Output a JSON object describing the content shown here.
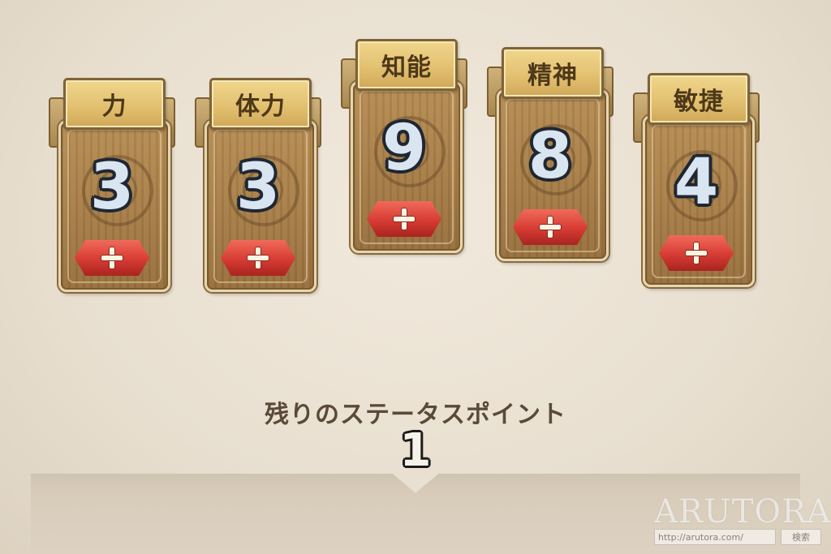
{
  "stats": [
    {
      "label": "力",
      "value": "3",
      "plus_icon": "plus-icon"
    },
    {
      "label": "体力",
      "value": "3",
      "plus_icon": "plus-icon"
    },
    {
      "label": "知能",
      "value": "9",
      "plus_icon": "plus-icon"
    },
    {
      "label": "精神",
      "value": "8",
      "plus_icon": "plus-icon"
    },
    {
      "label": "敏捷",
      "value": "4",
      "plus_icon": "plus-icon"
    }
  ],
  "remaining": {
    "label": "残りのステータスポイント",
    "value": "1"
  },
  "watermark": {
    "logo": "ARUTORA",
    "url": "http://arutora.com/",
    "search_label": "検索"
  },
  "colors": {
    "plus_button": "#d63b33",
    "label_plate": "#e3c171",
    "card_wood": "#a57c47",
    "background": "#e8dfd0"
  }
}
